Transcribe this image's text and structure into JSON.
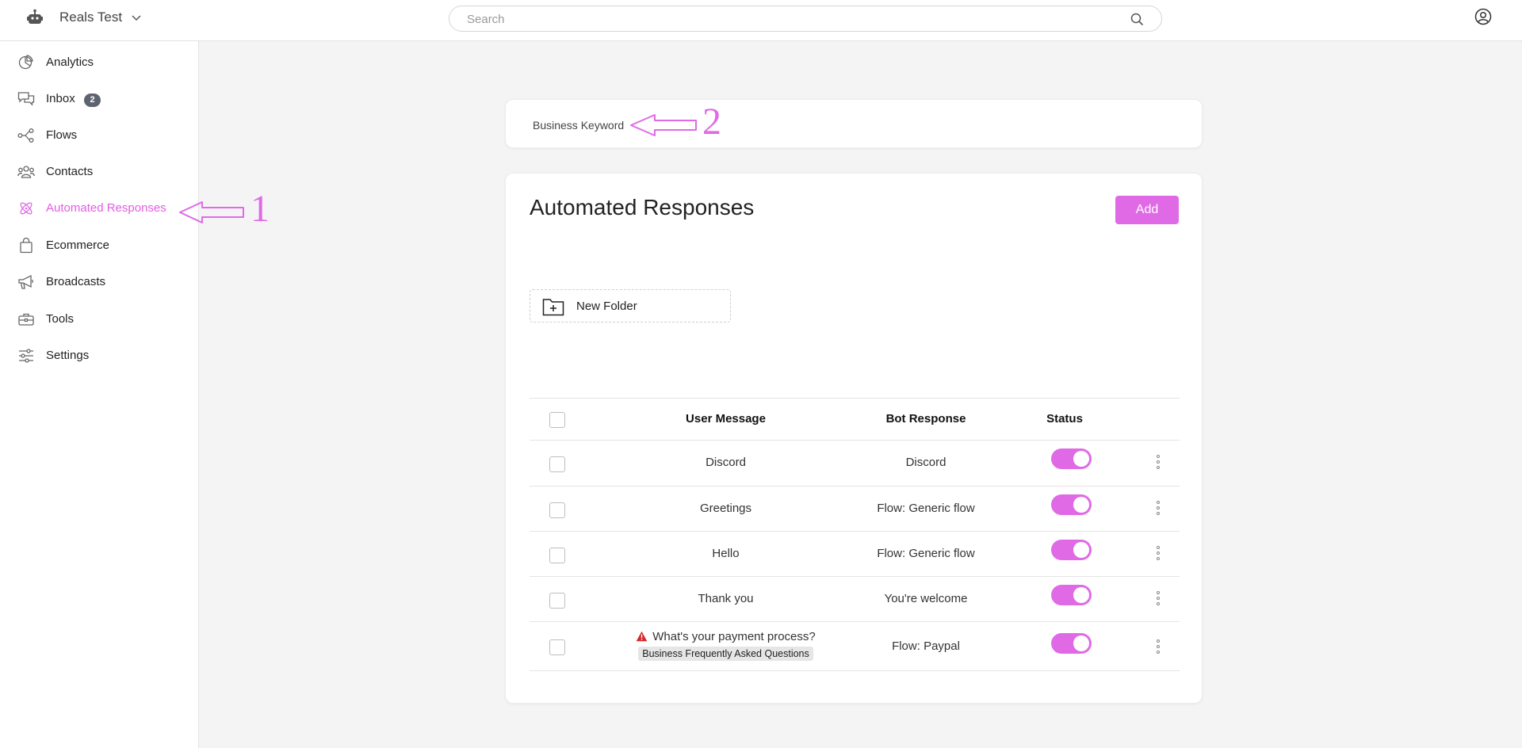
{
  "header": {
    "workspace_name": "Reals Test",
    "search_placeholder": "Search"
  },
  "sidebar": {
    "items": [
      {
        "label": "Analytics",
        "icon": "pie-chart-icon"
      },
      {
        "label": "Inbox",
        "icon": "chat-bubbles-icon",
        "badge": "2"
      },
      {
        "label": "Flows",
        "icon": "flow-nodes-icon"
      },
      {
        "label": "Contacts",
        "icon": "people-icon"
      },
      {
        "label": "Automated Responses",
        "icon": "atom-icon",
        "active": true
      },
      {
        "label": "Ecommerce",
        "icon": "shopping-bag-icon"
      },
      {
        "label": "Broadcasts",
        "icon": "megaphone-icon"
      },
      {
        "label": "Tools",
        "icon": "toolbox-icon"
      },
      {
        "label": "Settings",
        "icon": "sliders-icon"
      }
    ]
  },
  "keyword_card": {
    "label": "Business Keyword"
  },
  "main": {
    "title": "Automated Responses",
    "add_button": "Add",
    "new_folder": "New Folder",
    "table": {
      "headers": [
        "User Message",
        "Bot Response",
        "Status"
      ],
      "rows": [
        {
          "user_message": "Discord",
          "bot_response": "Discord",
          "status": "on"
        },
        {
          "user_message": "Greetings",
          "bot_response": "Flow: Generic flow",
          "status": "on"
        },
        {
          "user_message": "Hello",
          "bot_response": "Flow: Generic flow",
          "status": "on"
        },
        {
          "user_message": "Thank you",
          "bot_response": "You're welcome",
          "status": "on"
        },
        {
          "user_message": "What's your payment process?",
          "tag": "Business Frequently Asked Questions",
          "warning": true,
          "bot_response": "Flow: Paypal",
          "status": "on"
        }
      ]
    }
  },
  "annotations": [
    "1",
    "2"
  ],
  "colors": {
    "accent": "#e06ae6",
    "badge": "#5d6470",
    "warning": "#d9262b"
  }
}
